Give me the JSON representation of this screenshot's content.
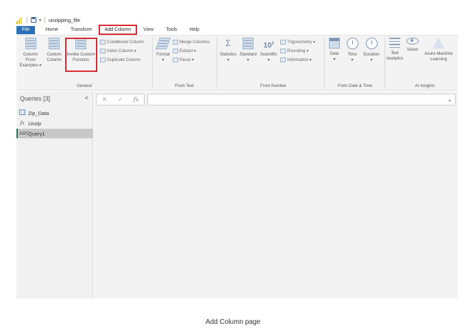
{
  "window": {
    "title": "unzipping_file"
  },
  "tabs": [
    {
      "label": "File"
    },
    {
      "label": "Home"
    },
    {
      "label": "Transform"
    },
    {
      "label": "Add Column"
    },
    {
      "label": "View"
    },
    {
      "label": "Tools"
    },
    {
      "label": "Help"
    }
  ],
  "ribbon": {
    "general": {
      "column_from_examples": [
        "Column From",
        "Examples ▾"
      ],
      "custom_column": [
        "Custom",
        "Column"
      ],
      "invoke_custom_function": [
        "Invoke Custom",
        "Function"
      ],
      "group_label": "General"
    },
    "small": {
      "conditional_column": "Conditional Column",
      "index_column": "Index Column ▾",
      "duplicate_column": "Duplicate Column"
    },
    "from_text": {
      "format": "Format",
      "merge_columns": "Merge Columns",
      "extract": "Extract ▾",
      "parse": "Parse ▾",
      "group_label": "From Text"
    },
    "from_number": {
      "statistics": "Statistics",
      "standard": "Standard",
      "scientific": "Scientific",
      "exp_symbol": "10",
      "exp_power": "2",
      "trigonometry": "Trigonometry ▾",
      "rounding": "Rounding ▾",
      "information": "Information ▾",
      "group_label": "From Number"
    },
    "from_date_time": {
      "date": "Date",
      "time": "Time",
      "duration": "Duration",
      "group_label": "From Date & Time"
    },
    "ai_insights": {
      "text_analytics": [
        "Text",
        "Analytics"
      ],
      "vision": "Vision",
      "azure_ml": [
        "Azure Machine",
        "Learning"
      ],
      "group_label": "AI Insights"
    }
  },
  "queries": {
    "header": "Queries [3]",
    "items": [
      {
        "label": "Zip_Data",
        "icon": "table-icon"
      },
      {
        "label": "Unzip",
        "icon": "function-icon"
      },
      {
        "label": "Query1",
        "icon": "text-type-icon"
      }
    ]
  },
  "formula_bar": {
    "cancel": "✕",
    "commit": "✓",
    "fx": "fx",
    "expand": "⌄"
  },
  "caption": "Add Column page",
  "colors": {
    "file_tab": "#2b6fb8",
    "highlight": "#d9262c",
    "selected_query_marker": "#217346"
  }
}
